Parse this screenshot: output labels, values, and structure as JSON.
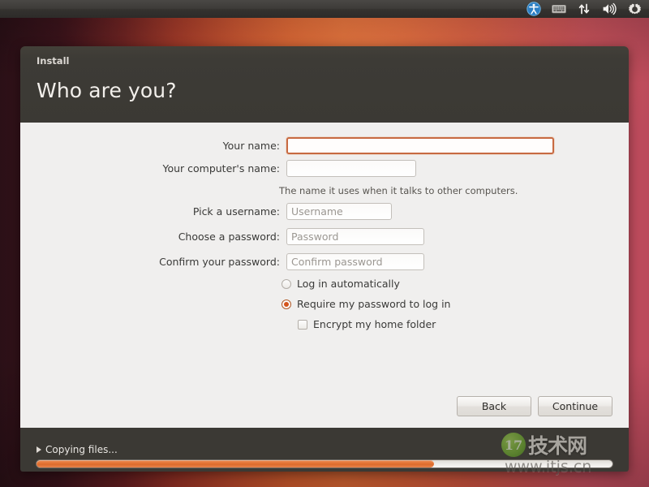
{
  "panel": {
    "tray": [
      {
        "name": "accessibility-icon",
        "label": "Universal Access"
      },
      {
        "name": "keyboard-icon",
        "label": "Keyboard Layout"
      },
      {
        "name": "network-icon",
        "label": "Network"
      },
      {
        "name": "volume-icon",
        "label": "Sound"
      },
      {
        "name": "session-icon",
        "label": "System Settings"
      }
    ]
  },
  "window": {
    "title": "Install",
    "heading": "Who are you?"
  },
  "form": {
    "fields": [
      {
        "label": "Your name:",
        "value": "",
        "placeholder": "",
        "focused": true
      },
      {
        "label": "Your computer's name:",
        "value": "",
        "placeholder": "",
        "focused": false
      },
      {
        "label": "Pick a username:",
        "value": "",
        "placeholder": "Username",
        "focused": false
      },
      {
        "label": "Choose a password:",
        "value": "",
        "placeholder": "Password",
        "focused": false
      },
      {
        "label": "Confirm your password:",
        "value": "",
        "placeholder": "Confirm password",
        "focused": false
      }
    ],
    "hint": "The name it uses when it talks to other computers.",
    "options": [
      {
        "label": "Log in automatically",
        "type": "radio",
        "selected": false
      },
      {
        "label": "Require my password to log in",
        "type": "radio",
        "selected": true
      },
      {
        "label": "Encrypt my home folder",
        "type": "checkbox",
        "selected": false
      }
    ]
  },
  "buttons": {
    "back": "Back",
    "continue": "Continue"
  },
  "footer": {
    "status": "Copying files...",
    "progress_percent": 69
  },
  "watermark": {
    "badge": "17",
    "name": "技术网",
    "url": "www.itjs.cn"
  },
  "colors": {
    "accent": "#d4541b",
    "progress": "#e57434",
    "header_bg": "#3b3934",
    "body_bg": "#f0efee",
    "focus_border": "#c76a42"
  }
}
